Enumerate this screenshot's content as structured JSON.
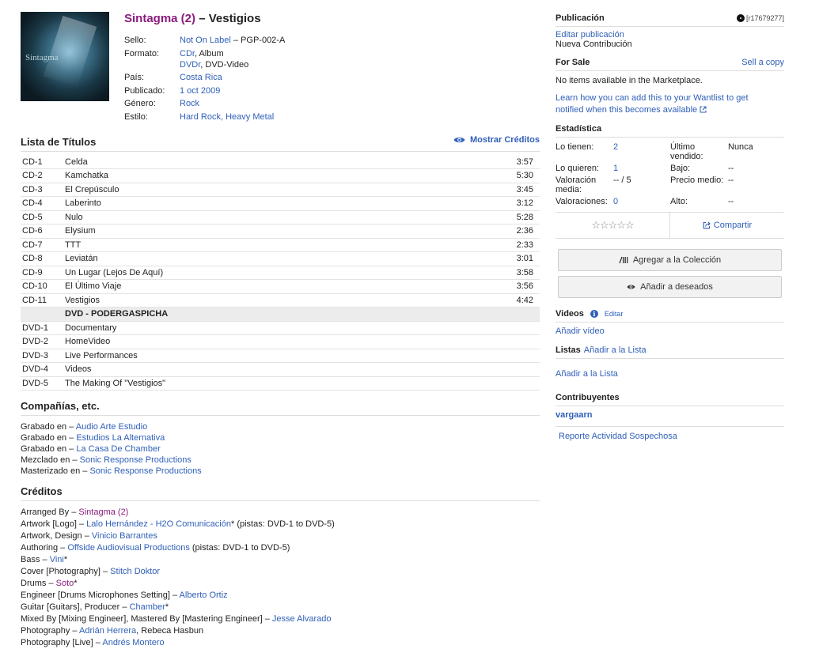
{
  "release": {
    "artist": "Sintagma (2)",
    "dash": "–",
    "title": "Vestigios",
    "cover_text": "Sintagma"
  },
  "profile": {
    "sello_label": "Sello:",
    "sello_link": "Not On Label",
    "sello_rest": " – PGP-002-A",
    "formato_label": "Formato:",
    "formato_1_link": "CDr",
    "formato_1_rest": ", Album",
    "formato_2_link": "DVDr",
    "formato_2_rest": ", DVD-Video",
    "pais_label": "País:",
    "pais": "Costa Rica",
    "publicado_label": "Publicado:",
    "publicado": "1 oct 2009",
    "genero_label": "Género:",
    "genero": "Rock",
    "estilo_label": "Estilo:",
    "estilo_1": "Hard Rock",
    "estilo_sep": ", ",
    "estilo_2": "Heavy Metal"
  },
  "tracklist": {
    "heading": "Lista de Títulos",
    "toggle": "Mostrar Créditos",
    "rows": [
      {
        "pos": "CD-1",
        "title": "Celda",
        "dur": "3:57"
      },
      {
        "pos": "CD-2",
        "title": "Kamchatka",
        "dur": "5:30"
      },
      {
        "pos": "CD-3",
        "title": "El Crepúsculo",
        "dur": "3:45"
      },
      {
        "pos": "CD-4",
        "title": "Laberinto",
        "dur": "3:12"
      },
      {
        "pos": "CD-5",
        "title": "Nulo",
        "dur": "5:28"
      },
      {
        "pos": "CD-6",
        "title": "Elysium",
        "dur": "2:36"
      },
      {
        "pos": "CD-7",
        "title": "TTT",
        "dur": "2:33"
      },
      {
        "pos": "CD-8",
        "title": "Leviatán",
        "dur": "3:01"
      },
      {
        "pos": "CD-9",
        "title": "Un Lugar (Lejos De Aquí)",
        "dur": "3:58"
      },
      {
        "pos": "CD-10",
        "title": "El Último Viaje",
        "dur": "3:56"
      },
      {
        "pos": "CD-11",
        "title": "Vestigios",
        "dur": "4:42"
      },
      {
        "pos": "",
        "title": "DVD - PODERGASPICHA",
        "dur": "",
        "heading": true
      },
      {
        "pos": "DVD-1",
        "title": "Documentary",
        "dur": ""
      },
      {
        "pos": "DVD-2",
        "title": "HomeVideo",
        "dur": ""
      },
      {
        "pos": "DVD-3",
        "title": "Live Performances",
        "dur": ""
      },
      {
        "pos": "DVD-4",
        "title": "Videos",
        "dur": ""
      },
      {
        "pos": "DVD-5",
        "title": "The Making Of \"Vestigios\"",
        "dur": ""
      }
    ]
  },
  "companies": {
    "heading": "Compañías, etc.",
    "items": [
      {
        "role": "Grabado en – ",
        "name": "Audio Arte Estudio"
      },
      {
        "role": "Grabado en – ",
        "name": "Estudios La Alternativa"
      },
      {
        "role": "Grabado en – ",
        "name": "La Casa De Chamber"
      },
      {
        "role": "Mezclado en – ",
        "name": "Sonic Response Productions"
      },
      {
        "role": "Masterizado en – ",
        "name": "Sonic Response Productions"
      }
    ]
  },
  "credits": {
    "heading": "Créditos",
    "items": [
      {
        "role": "Arranged By – ",
        "name": "Sintagma (2)",
        "artist": true,
        "suffix": ""
      },
      {
        "role": "Artwork [Logo] – ",
        "name": "Lalo Hernández - H2O Comunicación",
        "suffix": "* (pistas: DVD-1 to DVD-5)"
      },
      {
        "role": "Artwork, Design – ",
        "name": "Vinicio Barrantes",
        "suffix": ""
      },
      {
        "role": "Authoring – ",
        "name": "Offside Audiovisual Productions",
        "suffix": " (pistas: DVD-1 to DVD-5)"
      },
      {
        "role": "Bass – ",
        "name": "Vini",
        "suffix": "*"
      },
      {
        "role": "Cover [Photography] – ",
        "name": "Stitch Doktor",
        "suffix": ""
      },
      {
        "role": "Drums – ",
        "name": "Soto",
        "artist": true,
        "suffix": "*"
      },
      {
        "role": "Engineer [Drums Microphones Setting] – ",
        "name": "Alberto Ortiz",
        "suffix": ""
      },
      {
        "role": "Guitar [Guitars], Producer – ",
        "name": "Chamber",
        "suffix": "*"
      },
      {
        "role": "Mixed By [Mixing Engineer], Mastered By [Mastering Engineer] – ",
        "name": "Jesse Alvarado",
        "suffix": ""
      },
      {
        "role": "Photography – ",
        "name": "Adrián Herrera",
        "suffix": ", Rebeca Hasbun"
      },
      {
        "role": "Photography [Live] – ",
        "name": "Andrés Montero",
        "suffix": ""
      }
    ]
  },
  "sidebar": {
    "publicacion_heading": "Publicación",
    "release_id": "[r17679277]",
    "edit_link": "Editar publicación",
    "contrib_text": "Nueva Contribución",
    "forsale_heading": "For Sale",
    "sell_link": "Sell a copy",
    "no_items": "No items available in the Marketplace.",
    "wantlist_link": "Learn how you can add this to your Wantlist to get notified when this becomes available",
    "stats_heading": "Estadística",
    "stats": {
      "have_label": "Lo tienen:",
      "have": "2",
      "last_sold_label": "Último vendido:",
      "last_sold": "Nunca",
      "want_label": "Lo quieren:",
      "want": "1",
      "low_label": "Bajo:",
      "low": "--",
      "avg_label": "Valoración media:",
      "avg": "-- / 5",
      "median_label": "Precio medio:",
      "median": "--",
      "ratings_label": "Valoraciones:",
      "ratings": "0",
      "high_label": "Alto:",
      "high": "--"
    },
    "stars": "☆☆☆☆☆",
    "share": "Compartir",
    "add_collection": "Agregar a la Colección",
    "add_wantlist": "Añadir a deseados",
    "videos_heading": "Videos",
    "videos_edit": "Editar",
    "add_video": "Añadir vídeo",
    "lists_heading": "Listas",
    "lists_add_inline": "Añadir a la Lista",
    "lists_add": "Añadir a la Lista",
    "contributors_heading": "Contribuyentes",
    "contributor": "vargaarn",
    "report": "Reporte Actividad Sospechosa"
  },
  "colors": {
    "link": "#2f5fb8",
    "artist": "#8a1c7c",
    "border": "#dddddd"
  }
}
